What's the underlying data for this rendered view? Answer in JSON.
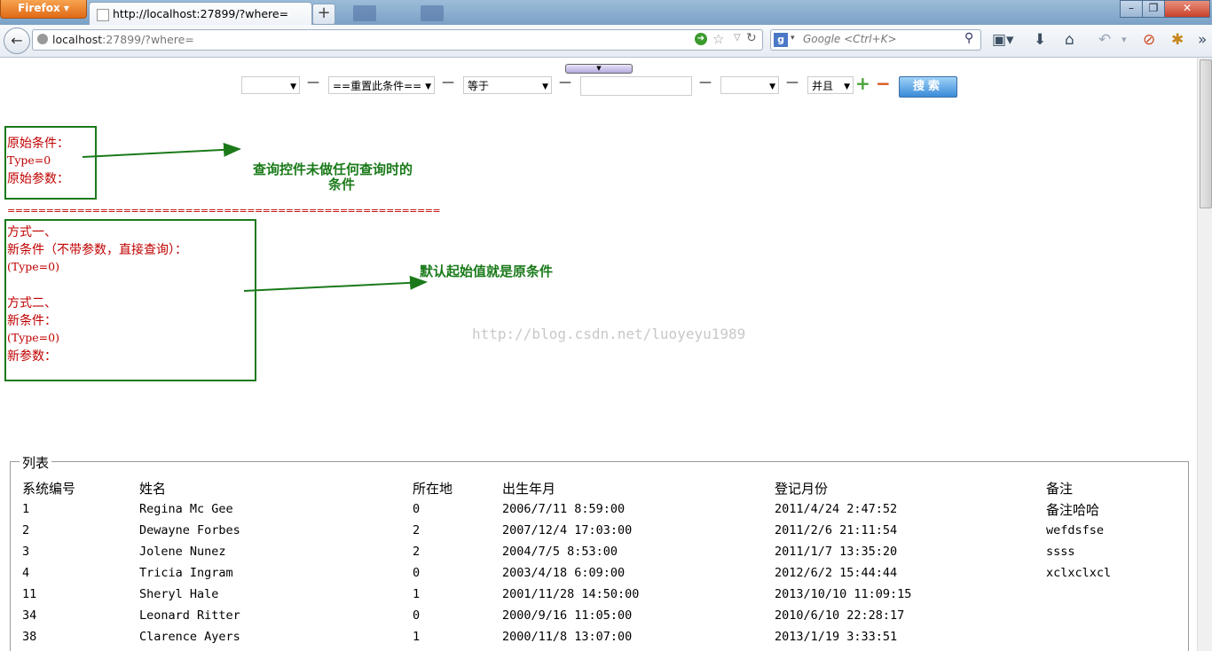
{
  "browser": {
    "app_button": "Firefox",
    "tab_title": "http://localhost:27899/?where=",
    "url_host": "localhost",
    "url_rest": ":27899/?where=",
    "search_placeholder": "Google <Ctrl+K>"
  },
  "filter": {
    "field1_value": "",
    "condition_reset": "==重置此条件==",
    "operator": "等于",
    "value": "",
    "field2_value": "",
    "logic": "并且",
    "search_button": "搜索"
  },
  "notes": {
    "orig_label1": "原始条件：",
    "orig_value": "Type=0",
    "orig_label2": "原始参数：",
    "annotation1_line1": "查询控件未做任何查询时的",
    "annotation1_line2": "条件",
    "separator": "========================================================",
    "method1": "方式一、",
    "method1_desc": "新条件（不带参数，直接查询）：",
    "method1_value": "(Type=0)",
    "method2": "方式二、",
    "method2_cond": "新条件：",
    "method2_value": "(Type=0)",
    "method2_params": "新参数：",
    "annotation2": "默认起始值就是原条件"
  },
  "watermark": "http://blog.csdn.net/luoyeyu1989",
  "table": {
    "legend": "列表",
    "columns": [
      "系统编号",
      "姓名",
      "所在地",
      "出生年月",
      "登记月份",
      "备注"
    ],
    "rows": [
      [
        "1",
        "Regina Mc Gee",
        "0",
        "2006/7/11 8:59:00",
        "2011/4/24 2:47:52",
        "备注哈哈"
      ],
      [
        "2",
        "Dewayne Forbes",
        "2",
        "2007/12/4 17:03:00",
        "2011/2/6 21:11:54",
        "wefdsfse"
      ],
      [
        "3",
        "Jolene Nunez",
        "2",
        "2004/7/5 8:53:00",
        "2011/1/7 13:35:20",
        "ssss"
      ],
      [
        "4",
        "Tricia Ingram",
        "0",
        "2003/4/18 6:09:00",
        "2012/6/2 15:44:44",
        "xclxclxcl"
      ],
      [
        "11",
        "Sheryl Hale",
        "1",
        "2001/11/28 14:50:00",
        "2013/10/10 11:09:15",
        ""
      ],
      [
        "34",
        "Leonard Ritter",
        "0",
        "2000/9/16 11:05:00",
        "2010/6/10 22:28:17",
        ""
      ],
      [
        "38",
        "Clarence Ayers",
        "1",
        "2000/11/8 13:07:00",
        "2013/1/19 3:33:51",
        ""
      ]
    ]
  },
  "colors": {
    "note_red": "#c00000",
    "annotation_green": "#1a7a1a"
  }
}
